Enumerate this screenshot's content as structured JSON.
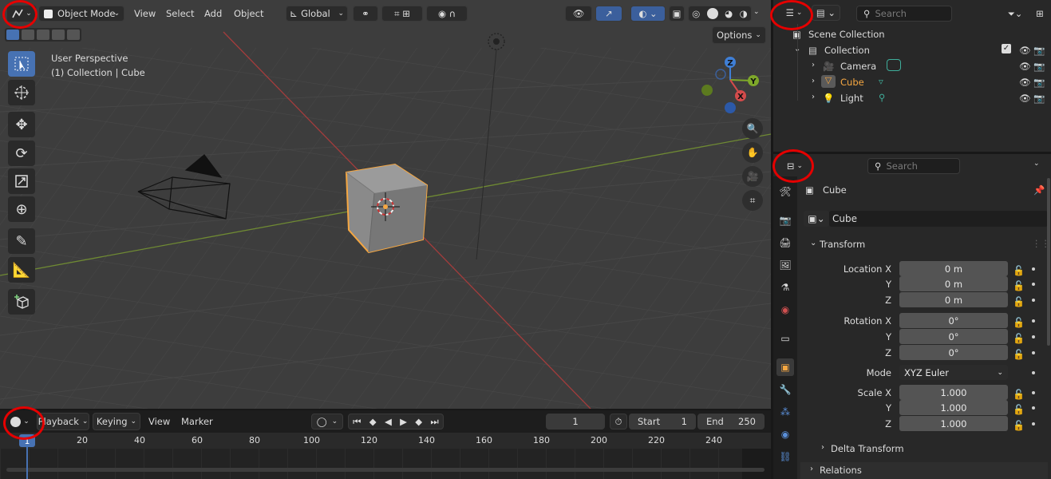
{
  "viewport": {
    "mode": "Object Mode",
    "menus": [
      "View",
      "Select",
      "Add",
      "Object"
    ],
    "transform_orientation": "Global",
    "options_label": "Options",
    "overlay_line1": "User Perspective",
    "overlay_line2": "(1) Collection | Cube",
    "gizmo_axes": {
      "z": "Z",
      "y": "Y",
      "x": "X"
    },
    "tools": [
      "select-box",
      "cursor",
      "move",
      "rotate",
      "scale",
      "transform",
      "annotate",
      "measure",
      "add-cube"
    ],
    "nav_buttons": [
      "zoom",
      "pan",
      "camera-view",
      "perspective-toggle"
    ]
  },
  "timeline": {
    "menus": [
      "Playback",
      "Keying",
      "View",
      "Marker"
    ],
    "current_frame": "1",
    "start_label": "Start",
    "start_value": "1",
    "end_label": "End",
    "end_value": "250",
    "ruler_marks": [
      "20",
      "40",
      "60",
      "80",
      "100",
      "120",
      "140",
      "160",
      "180",
      "200",
      "220",
      "240"
    ],
    "playhead": "1"
  },
  "outliner": {
    "search_placeholder": "Search",
    "scene_collection": "Scene Collection",
    "collection": "Collection",
    "items": [
      {
        "label": "Camera",
        "icon": "camera-icon",
        "data_icon": "camera-data-icon",
        "selected": false
      },
      {
        "label": "Cube",
        "icon": "mesh-icon",
        "data_icon": "mesh-data-icon",
        "selected": true
      },
      {
        "label": "Light",
        "icon": "light-icon",
        "data_icon": "light-data-icon",
        "selected": false
      }
    ]
  },
  "properties": {
    "search_placeholder": "Search",
    "object_name": "Cube",
    "datablock_name": "Cube",
    "transform_panel": "Transform",
    "location": {
      "label": "Location X",
      "x": "0 m",
      "y": "0 m",
      "z": "0 m"
    },
    "rotation": {
      "label": "Rotation X",
      "x": "0°",
      "y": "0°",
      "z": "0°"
    },
    "mode_label": "Mode",
    "mode_value": "XYZ Euler",
    "scale": {
      "label": "Scale X",
      "x": "1.000",
      "y": "1.000",
      "z": "1.000"
    },
    "axis_y": "Y",
    "axis_z": "Z",
    "delta_transform": "Delta Transform",
    "relations": "Relations"
  },
  "colors": {
    "accent_orange": "#f5a742",
    "selected_blue": "#4772b3",
    "red_highlight": "#e50000",
    "axis_red": "#d34b4b",
    "axis_green": "#7ea82a"
  }
}
